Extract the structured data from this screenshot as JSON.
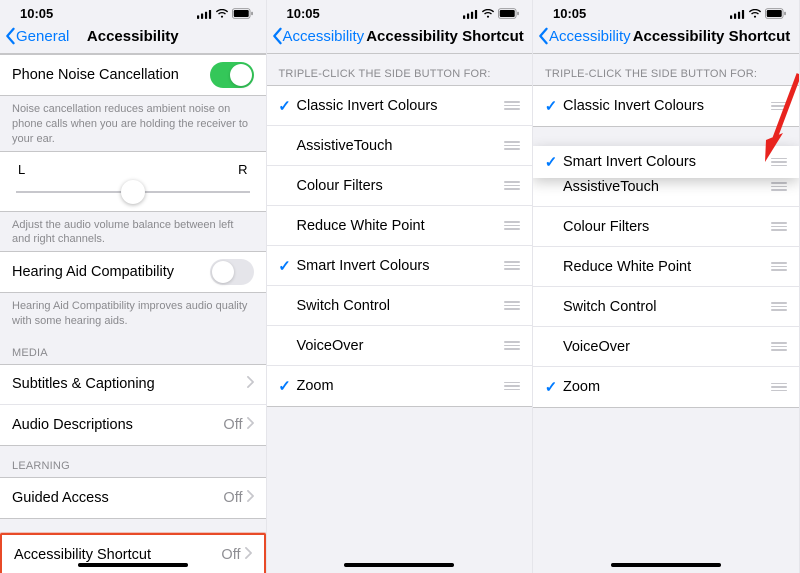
{
  "status": {
    "time": "10:05"
  },
  "screen1": {
    "back": "General",
    "title": "Accessibility",
    "noise_cancel": {
      "label": "Phone Noise Cancellation",
      "footer": "Noise cancellation reduces ambient noise on phone calls when you are holding the receiver to your ear."
    },
    "balance": {
      "left": "L",
      "right": "R",
      "footer": "Adjust the audio volume balance between left and right channels."
    },
    "hearing_aid": {
      "label": "Hearing Aid Compatibility",
      "footer": "Hearing Aid Compatibility improves audio quality with some hearing aids."
    },
    "media_header": "MEDIA",
    "subtitles": {
      "label": "Subtitles & Captioning"
    },
    "audio_desc": {
      "label": "Audio Descriptions",
      "value": "Off"
    },
    "learning_header": "LEARNING",
    "guided": {
      "label": "Guided Access",
      "value": "Off"
    },
    "shortcut": {
      "label": "Accessibility Shortcut",
      "value": "Off"
    }
  },
  "screen2": {
    "back": "Accessibility",
    "title": "Accessibility Shortcut",
    "header": "TRIPLE-CLICK THE SIDE BUTTON FOR:",
    "items": [
      {
        "label": "Classic Invert Colours",
        "checked": true
      },
      {
        "label": "AssistiveTouch",
        "checked": false
      },
      {
        "label": "Colour Filters",
        "checked": false
      },
      {
        "label": "Reduce White Point",
        "checked": false
      },
      {
        "label": "Smart Invert Colours",
        "checked": true
      },
      {
        "label": "Switch Control",
        "checked": false
      },
      {
        "label": "VoiceOver",
        "checked": false
      },
      {
        "label": "Zoom",
        "checked": true
      }
    ]
  },
  "screen3": {
    "back": "Accessibility",
    "title": "Accessibility Shortcut",
    "header": "TRIPLE-CLICK THE SIDE BUTTON FOR:",
    "floating": {
      "label": "Smart Invert Colours",
      "checked": true
    },
    "items": [
      {
        "label": "Classic Invert Colours",
        "checked": true
      },
      {
        "label": "AssistiveTouch",
        "checked": false
      },
      {
        "label": "Colour Filters",
        "checked": false
      },
      {
        "label": "Reduce White Point",
        "checked": false
      },
      {
        "label": "Switch Control",
        "checked": false
      },
      {
        "label": "VoiceOver",
        "checked": false
      },
      {
        "label": "Zoom",
        "checked": true
      }
    ]
  }
}
